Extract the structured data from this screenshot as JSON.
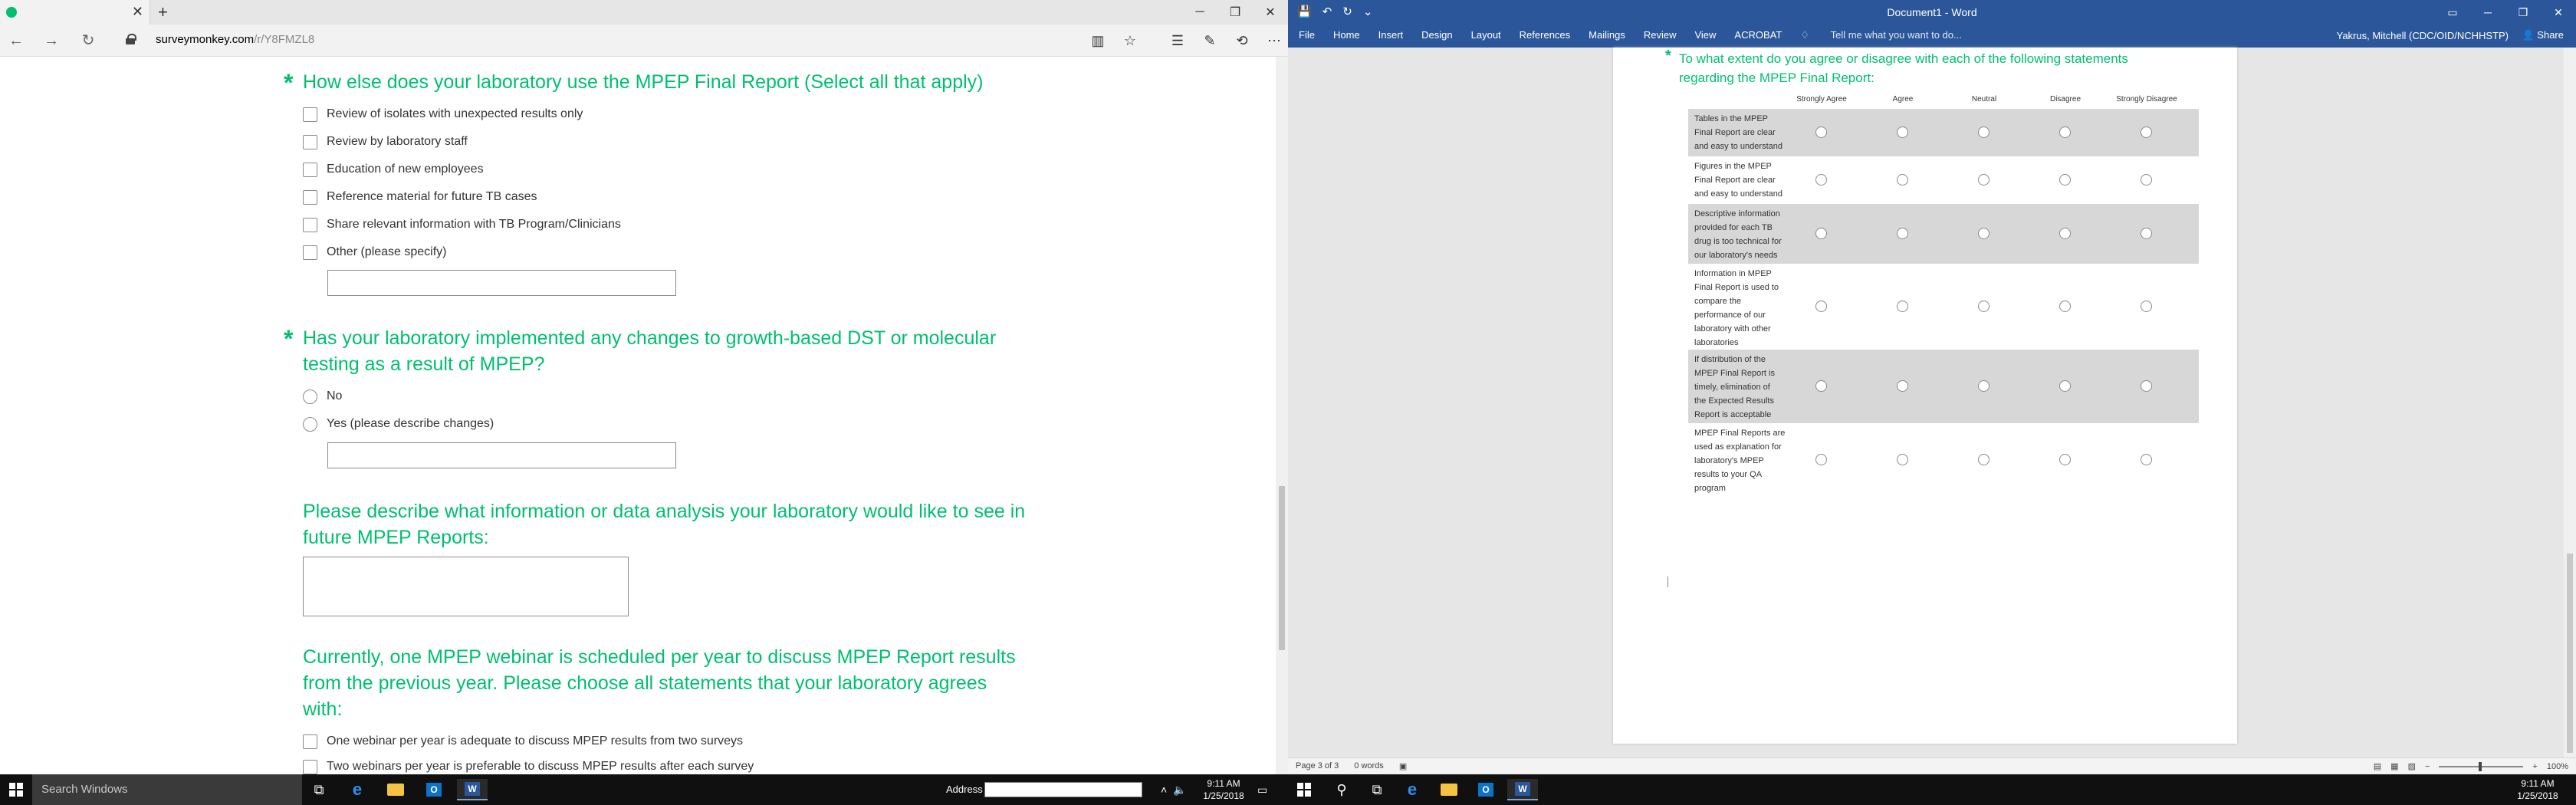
{
  "edge": {
    "url_domain": "surveymonkey.com",
    "url_path": "/r/Y8FMZL8",
    "nav": {
      "back": "←",
      "forward": "→",
      "refresh": "↻"
    },
    "tools": [
      "reading-view-icon",
      "favorite-star-icon",
      "hub-icon",
      "web-note-icon",
      "share-icon",
      "more-icon"
    ],
    "tab_close": "✕",
    "new_tab": "+",
    "win": {
      "minimize": "─",
      "restore": "❐",
      "close": "✕"
    }
  },
  "survey": {
    "q1": {
      "title": "How else does your laboratory use the MPEP Final Report (Select all that apply)",
      "options": [
        "Review of isolates with unexpected results only",
        "Review by laboratory staff",
        "Education of new employees",
        "Reference material for future TB cases",
        "Share relevant information with TB Program/Clinicians",
        "Other (please specify)"
      ]
    },
    "q2": {
      "title_line1": "Has your laboratory implemented any changes to growth-based DST or molecular",
      "title_line2": "testing as a result of MPEP?",
      "options": [
        "No",
        "Yes (please describe changes)"
      ]
    },
    "q3": {
      "title_line1": "Please describe what information or data analysis your laboratory would like to see in",
      "title_line2": "future MPEP Reports:"
    },
    "q4": {
      "title_line1": "Currently, one MPEP webinar is scheduled per year to discuss MPEP Report results",
      "title_line2": "from the previous year. Please choose all statements that your laboratory agrees",
      "title_line3": "with:",
      "options": [
        "One webinar per year is adequate to discuss MPEP results from two surveys",
        "Two webinars per year is preferable to discuss MPEP results after each survey"
      ]
    },
    "required_mark": "*"
  },
  "taskbar_left": {
    "search_placeholder": "Search Windows",
    "address_label": "Address",
    "time": "9:11 AM",
    "date": "1/25/2018",
    "outlook_letter": "O",
    "word_letter": "W"
  },
  "word": {
    "title": "Document1 - Word",
    "tabs": [
      "File",
      "Home",
      "Insert",
      "Design",
      "Layout",
      "References",
      "Mailings",
      "Review",
      "View",
      "ACROBAT"
    ],
    "tell_me": "Tell me what you want to do...",
    "user": "Yakrus, Mitchell (CDC/OID/NCHHSTP)",
    "share": "Share",
    "question_line1": "To what extent do you agree or disagree with each of the following statements",
    "question_line2": "regarding the MPEP Final Report:",
    "columns": [
      "Strongly Agree",
      "Agree",
      "Neutral",
      "Disagree",
      "Strongly Disagree"
    ],
    "rows": [
      [
        "Tables in the MPEP",
        "Final Report are clear",
        "and easy to understand"
      ],
      [
        "Figures in the MPEP",
        "Final Report are clear",
        "and easy to understand"
      ],
      [
        "Descriptive information",
        "provided for each TB",
        "drug is too technical for",
        "our laboratory's needs"
      ],
      [
        "Information in MPEP",
        "Final Report is used to",
        "compare the",
        "performance of our",
        "laboratory with other",
        "laboratories"
      ],
      [
        "If distribution of the",
        "MPEP Final Report is",
        "timely, elimination of",
        "the Expected Results",
        "Report is acceptable"
      ],
      [
        "MPEP Final Reports are",
        "used as explanation for",
        "laboratory's MPEP",
        "results to your QA",
        "program"
      ]
    ],
    "status_page": "Page 3 of 3",
    "status_words": "0 words",
    "zoom": "100%"
  },
  "taskbar_right": {
    "time": "9:11 AM",
    "date": "1/25/2018",
    "outlook_letter": "O",
    "word_letter": "W"
  }
}
